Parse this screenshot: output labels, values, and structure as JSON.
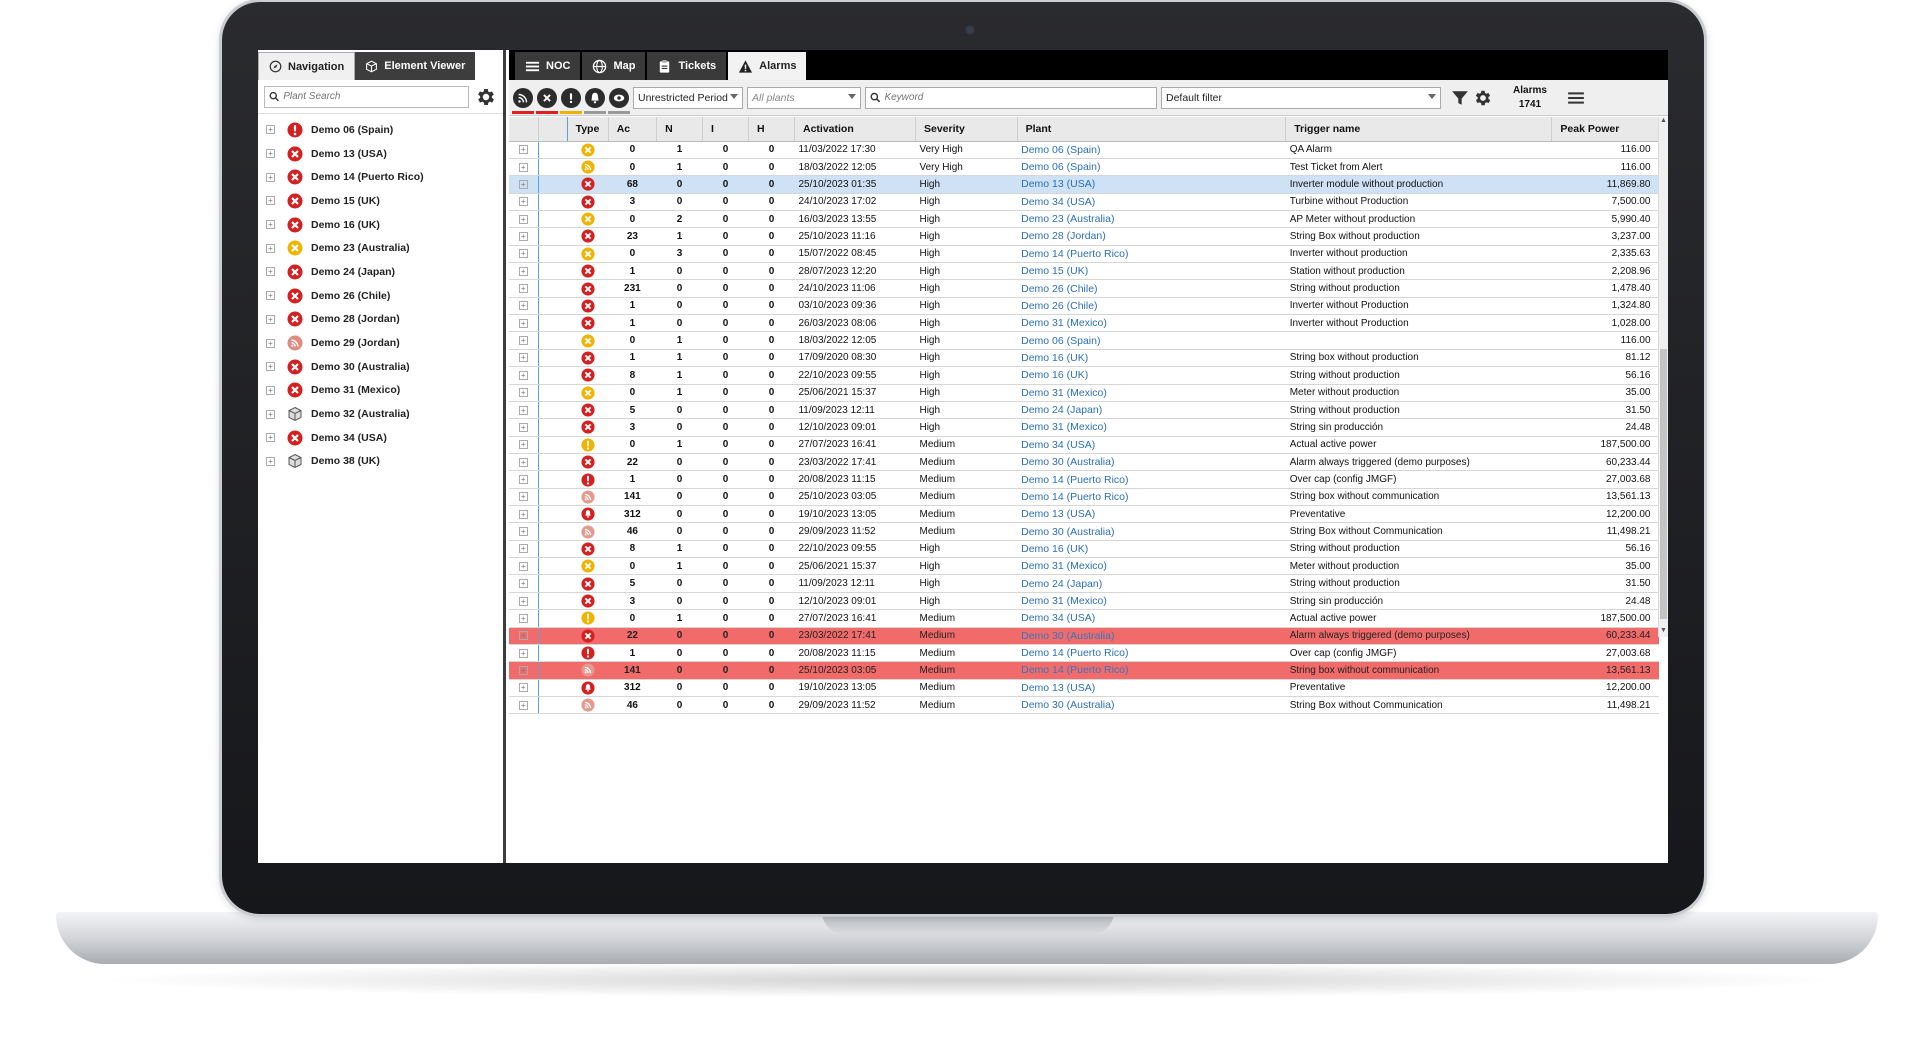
{
  "left_panel": {
    "tabs": [
      {
        "label": "Navigation",
        "icon": "compass-icon"
      },
      {
        "label": "Element Viewer",
        "icon": "cube-icon"
      }
    ],
    "search_placeholder": "Plant Search",
    "plants": [
      {
        "label": "Demo 06 (Spain)",
        "icon": "alert-red"
      },
      {
        "label": "Demo 13 (USA)",
        "icon": "x-red"
      },
      {
        "label": "Demo 14 (Puerto Rico)",
        "icon": "x-red"
      },
      {
        "label": "Demo 15 (UK)",
        "icon": "x-red"
      },
      {
        "label": "Demo 16 (UK)",
        "icon": "x-red"
      },
      {
        "label": "Demo 23 (Australia)",
        "icon": "x-yellow"
      },
      {
        "label": "Demo 24 (Japan)",
        "icon": "x-red"
      },
      {
        "label": "Demo 26 (Chile)",
        "icon": "x-red"
      },
      {
        "label": "Demo 28 (Jordan)",
        "icon": "x-red"
      },
      {
        "label": "Demo 29 (Jordan)",
        "icon": "signal"
      },
      {
        "label": "Demo 30 (Australia)",
        "icon": "x-red"
      },
      {
        "label": "Demo 31 (Mexico)",
        "icon": "x-red"
      },
      {
        "label": "Demo 32 (Australia)",
        "icon": "cube"
      },
      {
        "label": "Demo 34 (USA)",
        "icon": "x-red"
      },
      {
        "label": "Demo 38 (UK)",
        "icon": "cube"
      }
    ]
  },
  "main_tabs": [
    {
      "label": "NOC",
      "icon": "list-icon"
    },
    {
      "label": "Map",
      "icon": "globe-icon"
    },
    {
      "label": "Tickets",
      "icon": "clipboard-icon"
    },
    {
      "label": "Alarms",
      "icon": "warning-icon"
    }
  ],
  "toolbar": {
    "filter_buttons": [
      {
        "icon": "signal-icon",
        "bar": "#e02020"
      },
      {
        "icon": "x-icon",
        "bar": "#e02020"
      },
      {
        "icon": "exclamation-icon",
        "bar": "#f0b400"
      },
      {
        "icon": "bell-icon",
        "bar": "#999999"
      },
      {
        "icon": "eye-icon",
        "bar": "#999999"
      }
    ],
    "period": "Unrestricted Period",
    "plants_placeholder": "All plants",
    "keyword_placeholder": "Keyword",
    "filter": "Default filter",
    "alarms_label": "Alarms",
    "alarms_count": "1741"
  },
  "columns": [
    "",
    "Type",
    "Ac",
    "N",
    "I",
    "H",
    "Activation",
    "Severity",
    "Plant",
    "Trigger name",
    "Peak Power"
  ],
  "rows": [
    {
      "type": "x-yellow",
      "ac": "0",
      "n": "1",
      "i": "0",
      "h": "0",
      "act": "11/03/2022 17:30",
      "sev": "Very High",
      "plant": "Demo 06 (Spain)",
      "trig": "QA Alarm",
      "pp": "116.00",
      "state": ""
    },
    {
      "type": "signal-yellow",
      "ac": "0",
      "n": "1",
      "i": "0",
      "h": "0",
      "act": "18/03/2022 12:05",
      "sev": "Very High",
      "plant": "Demo 06 (Spain)",
      "trig": "Test Ticket from Alert",
      "pp": "116.00",
      "state": ""
    },
    {
      "type": "x-red",
      "ac": "68",
      "n": "0",
      "i": "0",
      "h": "0",
      "act": "25/10/2023 01:35",
      "sev": "High",
      "plant": "Demo 13 (USA)",
      "trig": "Inverter module without production",
      "pp": "11,869.80",
      "state": "selected"
    },
    {
      "type": "x-red",
      "ac": "3",
      "n": "0",
      "i": "0",
      "h": "0",
      "act": "24/10/2023 17:02",
      "sev": "High",
      "plant": "Demo 34 (USA)",
      "trig": "Turbine without Production",
      "pp": "7,500.00",
      "state": ""
    },
    {
      "type": "x-yellow",
      "ac": "0",
      "n": "2",
      "i": "0",
      "h": "0",
      "act": "16/03/2023 13:55",
      "sev": "High",
      "plant": "Demo 23 (Australia)",
      "trig": "AP Meter without production",
      "pp": "5,990.40",
      "state": ""
    },
    {
      "type": "x-red",
      "ac": "23",
      "n": "1",
      "i": "0",
      "h": "0",
      "act": "25/10/2023 11:16",
      "sev": "High",
      "plant": "Demo 28 (Jordan)",
      "trig": "String Box without production",
      "pp": "3,237.00",
      "state": ""
    },
    {
      "type": "x-yellow",
      "ac": "0",
      "n": "3",
      "i": "0",
      "h": "0",
      "act": "15/07/2022 08:45",
      "sev": "High",
      "plant": "Demo 14 (Puerto Rico)",
      "trig": "Inverter without production",
      "pp": "2,335.63",
      "state": ""
    },
    {
      "type": "x-red",
      "ac": "1",
      "n": "0",
      "i": "0",
      "h": "0",
      "act": "28/07/2023 12:20",
      "sev": "High",
      "plant": "Demo 15 (UK)",
      "trig": "Station without production",
      "pp": "2,208.96",
      "state": ""
    },
    {
      "type": "x-red",
      "ac": "231",
      "n": "0",
      "i": "0",
      "h": "0",
      "act": "24/10/2023 11:06",
      "sev": "High",
      "plant": "Demo 26 (Chile)",
      "trig": "String without production",
      "pp": "1,478.40",
      "state": ""
    },
    {
      "type": "x-red",
      "ac": "1",
      "n": "0",
      "i": "0",
      "h": "0",
      "act": "03/10/2023 09:36",
      "sev": "High",
      "plant": "Demo 26 (Chile)",
      "trig": "Inverter without Production",
      "pp": "1,324.80",
      "state": ""
    },
    {
      "type": "x-red",
      "ac": "1",
      "n": "0",
      "i": "0",
      "h": "0",
      "act": "26/03/2023 08:06",
      "sev": "High",
      "plant": "Demo 31 (Mexico)",
      "trig": "Inverter without Production",
      "pp": "1,028.00",
      "state": ""
    },
    {
      "type": "x-yellow",
      "ac": "0",
      "n": "1",
      "i": "0",
      "h": "0",
      "act": "18/03/2022 12:05",
      "sev": "High",
      "plant": "Demo 06 (Spain)",
      "trig": "",
      "pp": "116.00",
      "state": ""
    },
    {
      "type": "x-red",
      "ac": "1",
      "n": "1",
      "i": "0",
      "h": "0",
      "act": "17/09/2020 08:30",
      "sev": "High",
      "plant": "Demo 16 (UK)",
      "trig": "String box without production",
      "pp": "81.12",
      "state": ""
    },
    {
      "type": "x-red",
      "ac": "8",
      "n": "1",
      "i": "0",
      "h": "0",
      "act": "22/10/2023 09:55",
      "sev": "High",
      "plant": "Demo 16 (UK)",
      "trig": "String without production",
      "pp": "56.16",
      "state": ""
    },
    {
      "type": "x-yellow",
      "ac": "0",
      "n": "1",
      "i": "0",
      "h": "0",
      "act": "25/06/2021 15:37",
      "sev": "High",
      "plant": "Demo 31 (Mexico)",
      "trig": "Meter without production",
      "pp": "35.00",
      "state": ""
    },
    {
      "type": "x-red",
      "ac": "5",
      "n": "0",
      "i": "0",
      "h": "0",
      "act": "11/09/2023 12:11",
      "sev": "High",
      "plant": "Demo 24 (Japan)",
      "trig": "String without production",
      "pp": "31.50",
      "state": ""
    },
    {
      "type": "x-red",
      "ac": "3",
      "n": "0",
      "i": "0",
      "h": "0",
      "act": "12/10/2023 09:01",
      "sev": "High",
      "plant": "Demo 31 (Mexico)",
      "trig": "String sin producción",
      "pp": "24.48",
      "state": ""
    },
    {
      "type": "excl-yellow",
      "ac": "0",
      "n": "1",
      "i": "0",
      "h": "0",
      "act": "27/07/2023 16:41",
      "sev": "Medium",
      "plant": "Demo 34 (USA)",
      "trig": "Actual active power",
      "pp": "187,500.00",
      "state": ""
    },
    {
      "type": "x-red",
      "ac": "22",
      "n": "0",
      "i": "0",
      "h": "0",
      "act": "23/03/2022 17:41",
      "sev": "Medium",
      "plant": "Demo 30 (Australia)",
      "trig": "Alarm always triggered (demo purposes)",
      "pp": "60,233.44",
      "state": ""
    },
    {
      "type": "excl-red",
      "ac": "1",
      "n": "0",
      "i": "0",
      "h": "0",
      "act": "20/08/2023 11:15",
      "sev": "Medium",
      "plant": "Demo 14 (Puerto Rico)",
      "trig": "Over cap (config JMGF)",
      "pp": "27,003.68",
      "state": ""
    },
    {
      "type": "signal-red",
      "ac": "141",
      "n": "0",
      "i": "0",
      "h": "0",
      "act": "25/10/2023 03:05",
      "sev": "Medium",
      "plant": "Demo 14 (Puerto Rico)",
      "trig": "String box without communication",
      "pp": "13,561.13",
      "state": ""
    },
    {
      "type": "bell-red",
      "ac": "312",
      "n": "0",
      "i": "0",
      "h": "0",
      "act": "19/10/2023 13:05",
      "sev": "Medium",
      "plant": "Demo 13 (USA)",
      "trig": "Preventative",
      "pp": "12,200.00",
      "state": ""
    },
    {
      "type": "signal-red",
      "ac": "46",
      "n": "0",
      "i": "0",
      "h": "0",
      "act": "29/09/2023 11:52",
      "sev": "Medium",
      "plant": "Demo 30 (Australia)",
      "trig": "String Box without Communication",
      "pp": "11,498.21",
      "state": ""
    },
    {
      "type": "x-red",
      "ac": "8",
      "n": "1",
      "i": "0",
      "h": "0",
      "act": "22/10/2023 09:55",
      "sev": "High",
      "plant": "Demo 16 (UK)",
      "trig": "String without production",
      "pp": "56.16",
      "state": ""
    },
    {
      "type": "x-yellow",
      "ac": "0",
      "n": "1",
      "i": "0",
      "h": "0",
      "act": "25/06/2021 15:37",
      "sev": "High",
      "plant": "Demo 31 (Mexico)",
      "trig": "Meter without production",
      "pp": "35.00",
      "state": ""
    },
    {
      "type": "x-red",
      "ac": "5",
      "n": "0",
      "i": "0",
      "h": "0",
      "act": "11/09/2023 12:11",
      "sev": "High",
      "plant": "Demo 24 (Japan)",
      "trig": "String without production",
      "pp": "31.50",
      "state": ""
    },
    {
      "type": "x-red",
      "ac": "3",
      "n": "0",
      "i": "0",
      "h": "0",
      "act": "12/10/2023 09:01",
      "sev": "High",
      "plant": "Demo 31 (Mexico)",
      "trig": "String sin producción",
      "pp": "24.48",
      "state": ""
    },
    {
      "type": "excl-yellow",
      "ac": "0",
      "n": "1",
      "i": "0",
      "h": "0",
      "act": "27/07/2023 16:41",
      "sev": "Medium",
      "plant": "Demo 34 (USA)",
      "trig": "Actual active power",
      "pp": "187,500.00",
      "state": ""
    },
    {
      "type": "x-red",
      "ac": "22",
      "n": "0",
      "i": "0",
      "h": "0",
      "act": "23/03/2022 17:41",
      "sev": "Medium",
      "plant": "Demo 30 (Australia)",
      "trig": "Alarm always triggered (demo purposes)",
      "pp": "60,233.44",
      "state": "highlight"
    },
    {
      "type": "excl-red",
      "ac": "1",
      "n": "0",
      "i": "0",
      "h": "0",
      "act": "20/08/2023 11:15",
      "sev": "Medium",
      "plant": "Demo 14 (Puerto Rico)",
      "trig": "Over cap (config JMGF)",
      "pp": "27,003.68",
      "state": ""
    },
    {
      "type": "signal-red",
      "ac": "141",
      "n": "0",
      "i": "0",
      "h": "0",
      "act": "25/10/2023 03:05",
      "sev": "Medium",
      "plant": "Demo 14 (Puerto Rico)",
      "trig": "String box without communication",
      "pp": "13,561.13",
      "state": "highlight"
    },
    {
      "type": "bell-red",
      "ac": "312",
      "n": "0",
      "i": "0",
      "h": "0",
      "act": "19/10/2023 13:05",
      "sev": "Medium",
      "plant": "Demo 13 (USA)",
      "trig": "Preventative",
      "pp": "12,200.00",
      "state": ""
    },
    {
      "type": "signal-red",
      "ac": "46",
      "n": "0",
      "i": "0",
      "h": "0",
      "act": "29/09/2023 11:52",
      "sev": "Medium",
      "plant": "Demo 30 (Australia)",
      "trig": "String Box without Communication",
      "pp": "11,498.21",
      "state": ""
    }
  ],
  "colors": {
    "red": "#d42020",
    "yellow": "#f0b400",
    "link": "#2b6fb8",
    "highlight": "#f26b6b",
    "selected": "#cfe2f5"
  }
}
